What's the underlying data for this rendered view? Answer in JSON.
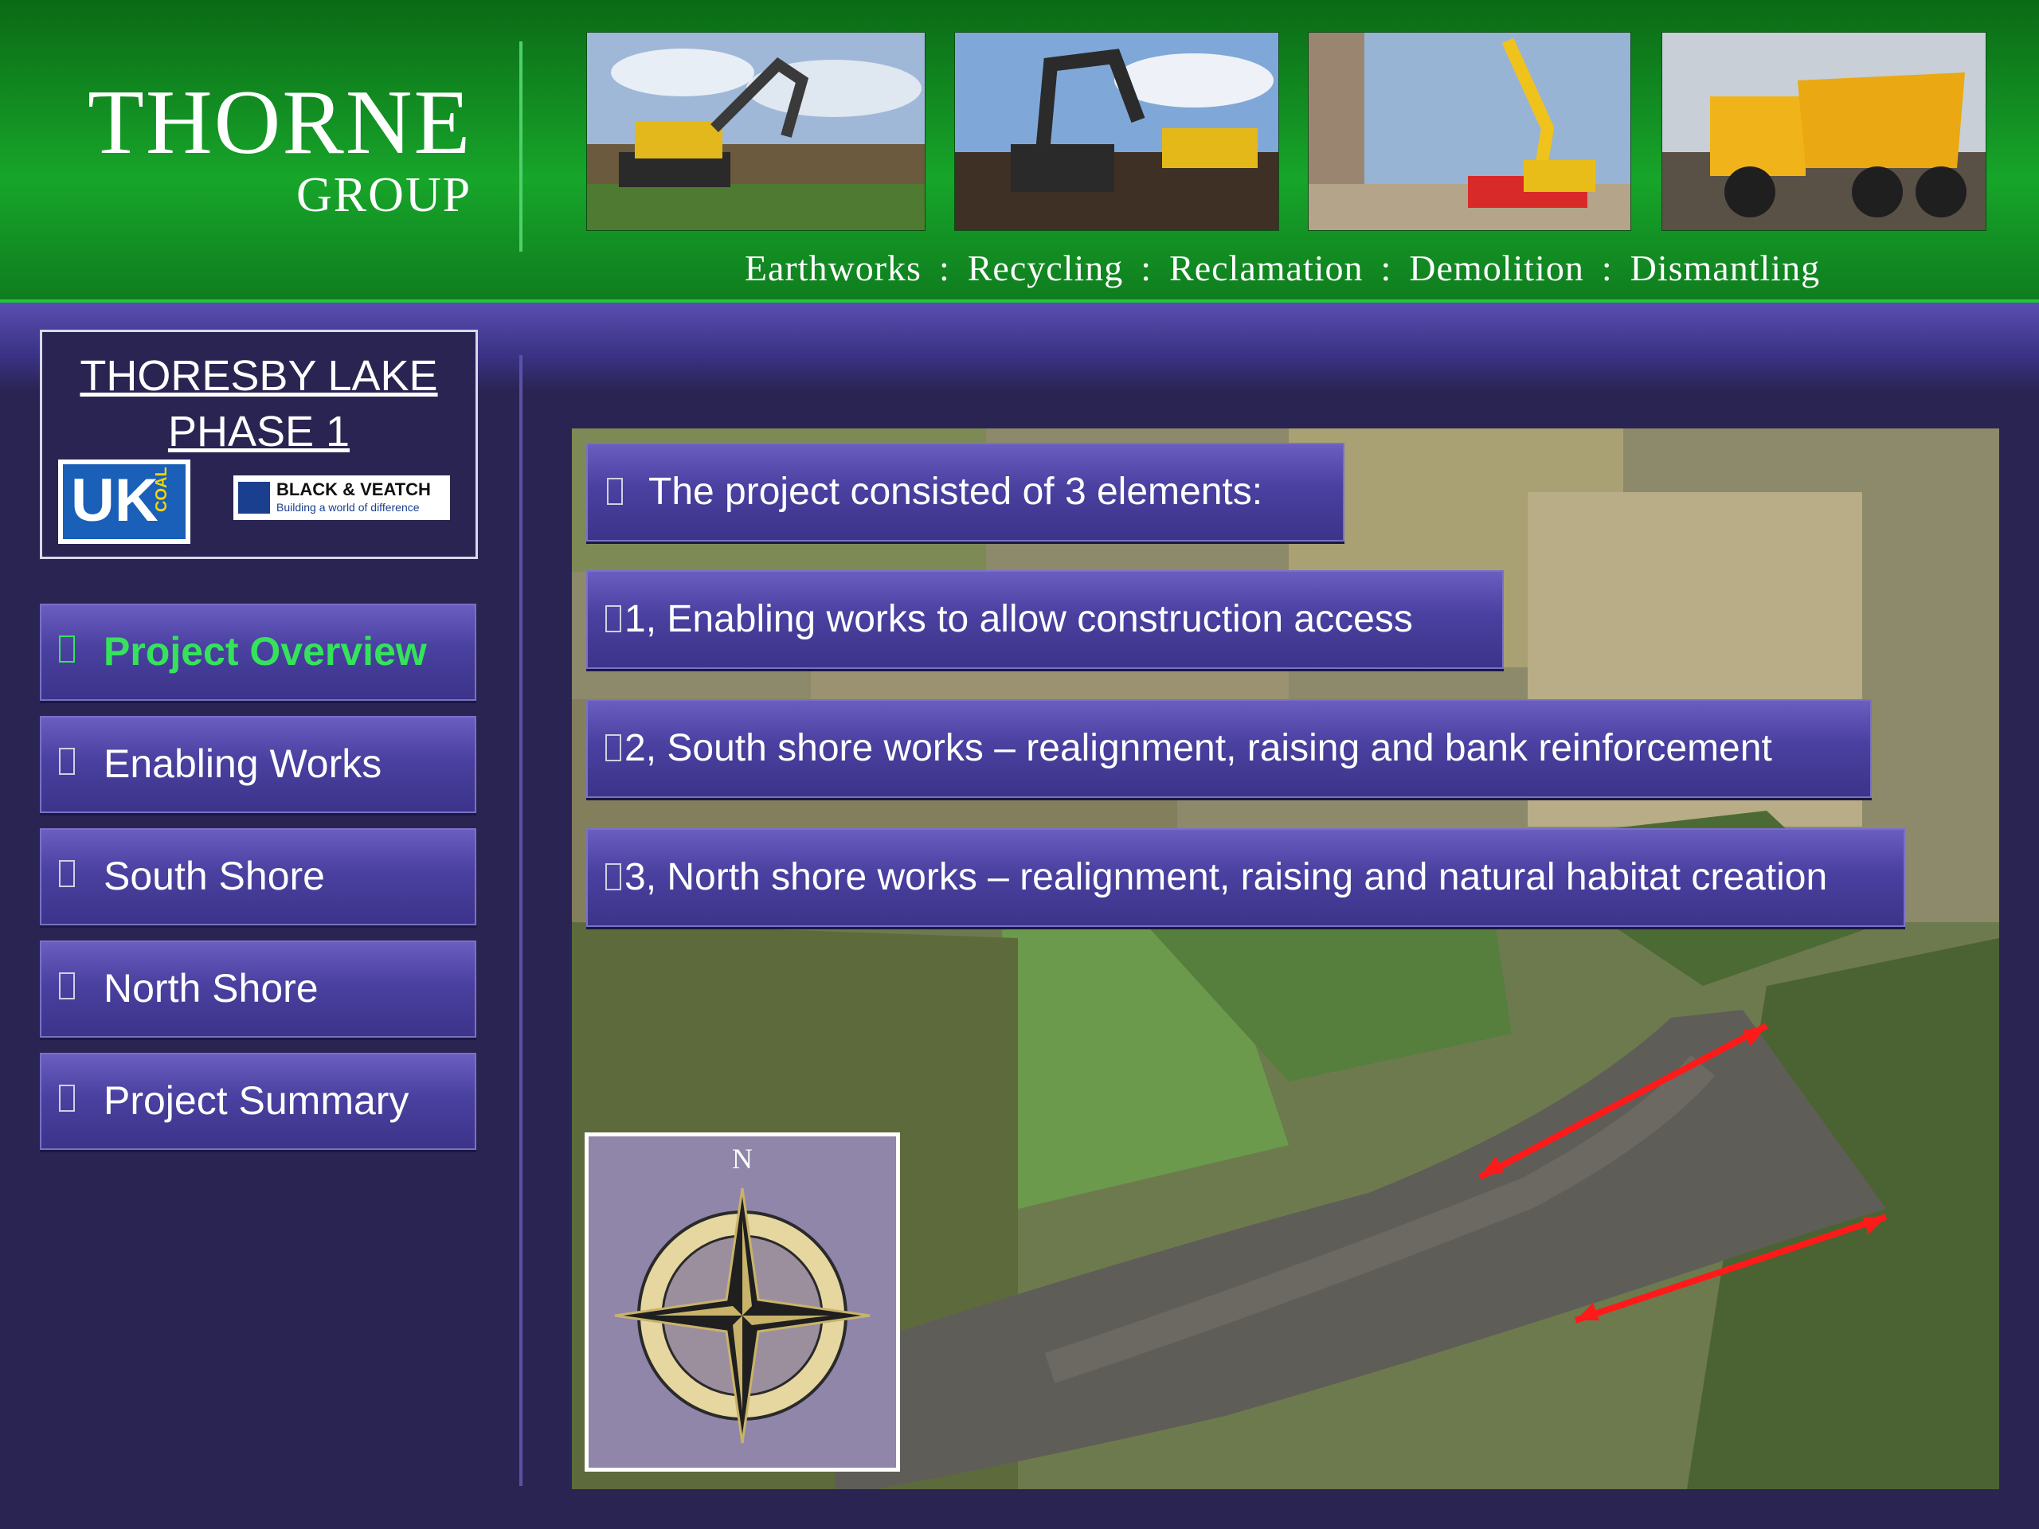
{
  "brand": {
    "title": "THORNE",
    "subtitle": "GROUP"
  },
  "tagline": [
    "Earthworks",
    "Recycling",
    "Reclamation",
    "Demolition",
    "Dismantling"
  ],
  "tagline_separator": ":",
  "project": {
    "title_line1": "THORESBY LAKE",
    "title_line2": "PHASE 1",
    "logo_uk_text": "UK",
    "logo_uk_small": "COAL",
    "logo_bv_text": "BLACK & VEATCH",
    "logo_bv_sub": "Building a world of difference"
  },
  "nav": [
    {
      "label": "Project Overview",
      "active": true
    },
    {
      "label": "Enabling Works",
      "active": false
    },
    {
      "label": "South Shore",
      "active": false
    },
    {
      "label": "North Shore",
      "active": false
    },
    {
      "label": "Project Summary",
      "active": false
    }
  ],
  "bullets": [
    "The project consisted of 3 elements:",
    "1, Enabling works to allow construction access",
    "2, South shore works – realignment, raising and bank reinforcement",
    "3, North shore works – realignment, raising and natural habitat creation"
  ],
  "compass": {
    "north_label": "N"
  },
  "colors": {
    "header_green": "#17a52a",
    "nav_purple": "#4a40a0",
    "background": "#2a2452",
    "active_text": "#35e35a",
    "arrow_red": "#ff1a1a"
  }
}
